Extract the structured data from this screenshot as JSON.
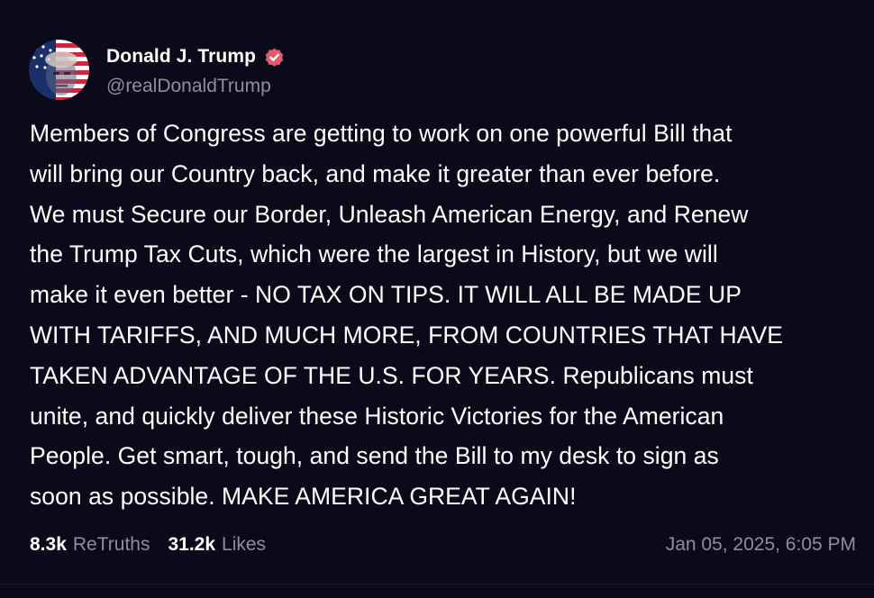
{
  "colors": {
    "background": "#0b0a1a",
    "text": "#ffffff",
    "muted": "#8f8ca6",
    "verified_badge": "#e35a6e"
  },
  "author": {
    "display_name": "Donald J. Trump",
    "handle": "@realDonaldTrump",
    "verified_icon": "verified-badge-icon",
    "avatar_icon": "flag-portrait-avatar"
  },
  "post": {
    "text": "Members of Congress are getting to work on one powerful Bill that\nwill bring our Country back, and make it greater than ever before.\nWe must Secure our Border, Unleash American Energy, and Renew\nthe Trump Tax Cuts, which were the largest in History, but we will\nmake it even better - NO TAX ON TIPS. IT WILL ALL BE MADE UP\nWITH TARIFFS, AND MUCH MORE, FROM COUNTRIES THAT HAVE\nTAKEN ADVANTAGE OF THE U.S. FOR YEARS. Republicans must\nunite, and quickly deliver these Historic Victories for the American\nPeople. Get smart, tough, and send the Bill to my desk to sign as\nsoon as possible. MAKE AMERICA GREAT AGAIN!"
  },
  "stats": {
    "retruths_count": "8.3k",
    "retruths_label": "ReTruths",
    "likes_count": "31.2k",
    "likes_label": "Likes"
  },
  "timestamp": "Jan 05, 2025, 6:05 PM"
}
